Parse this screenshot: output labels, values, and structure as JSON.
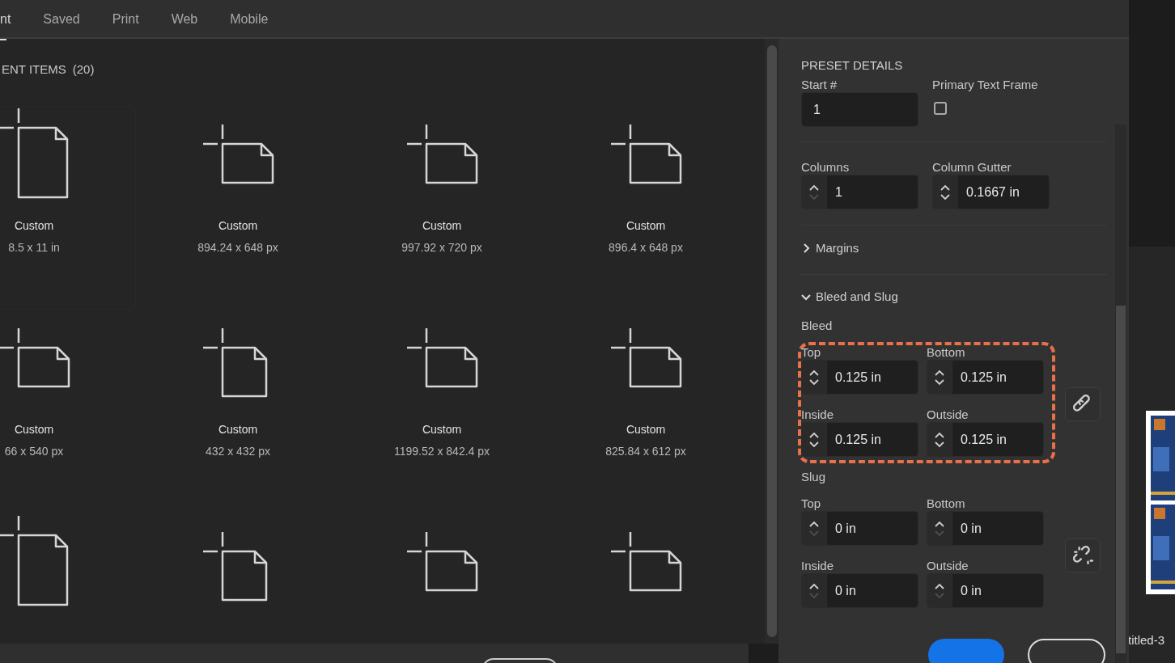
{
  "tabs": [
    {
      "label": "nt",
      "selected": true
    },
    {
      "label": "Saved",
      "selected": false
    },
    {
      "label": "Print",
      "selected": false
    },
    {
      "label": "Web",
      "selected": false
    },
    {
      "label": "Mobile",
      "selected": false
    }
  ],
  "recent_items": {
    "heading": "ENT ITEMS",
    "count": "(20)",
    "items": [
      {
        "kind": "portrait",
        "name": "Custom",
        "size": "8.5 x 11 in",
        "selected": true
      },
      {
        "kind": "landscape",
        "name": "Custom",
        "size": "894.24 x 648 px",
        "selected": false
      },
      {
        "kind": "landscape",
        "name": "Custom",
        "size": "997.92 x 720 px",
        "selected": false
      },
      {
        "kind": "landscape",
        "name": "Custom",
        "size": "896.4 x 648 px",
        "selected": false
      },
      {
        "kind": "landscape",
        "name": "Custom",
        "size": "66 x 540 px",
        "selected": false
      },
      {
        "kind": "square",
        "name": "Custom",
        "size": "432 x 432 px",
        "selected": false
      },
      {
        "kind": "landscape",
        "name": "Custom",
        "size": "1199.52 x 842.4 px",
        "selected": false
      },
      {
        "kind": "landscape",
        "name": "Custom",
        "size": "825.84 x 612 px",
        "selected": false
      },
      {
        "kind": "portrait",
        "selected": false
      },
      {
        "kind": "square",
        "selected": false
      },
      {
        "kind": "landscape",
        "selected": false
      },
      {
        "kind": "landscape",
        "selected": false
      }
    ]
  },
  "preset_details": {
    "title": "PRESET DETAILS",
    "start_number": {
      "label": "Start #",
      "value": "1"
    },
    "primary_text_frame": {
      "label": "Primary Text Frame",
      "checked": false
    },
    "columns": {
      "label": "Columns",
      "value": "1",
      "down_disabled": true
    },
    "column_gutter": {
      "label": "Column Gutter",
      "value": "0.1667 in",
      "down_disabled": false
    },
    "margins": {
      "label": "Margins",
      "expanded": false
    },
    "bleed_and_slug": {
      "label": "Bleed and Slug",
      "expanded": true,
      "groups": [
        {
          "label": "Bleed",
          "highlighted": true,
          "linked": true,
          "fields": [
            {
              "label": "Top",
              "value": "0.125 in",
              "down_disabled": false
            },
            {
              "label": "Bottom",
              "value": "0.125 in",
              "down_disabled": false
            },
            {
              "label": "Inside",
              "value": "0.125 in",
              "down_disabled": false
            },
            {
              "label": "Outside",
              "value": "0.125 in",
              "down_disabled": false
            }
          ]
        },
        {
          "label": "Slug",
          "highlighted": false,
          "linked": false,
          "fields": [
            {
              "label": "Top",
              "value": "0 in",
              "down_disabled": true
            },
            {
              "label": "Bottom",
              "value": "0 in",
              "down_disabled": true
            },
            {
              "label": "Inside",
              "value": "0 in",
              "down_disabled": true
            },
            {
              "label": "Outside",
              "value": "0 in",
              "down_disabled": true
            }
          ]
        }
      ]
    }
  },
  "recent_document": {
    "title": "titled-3"
  }
}
